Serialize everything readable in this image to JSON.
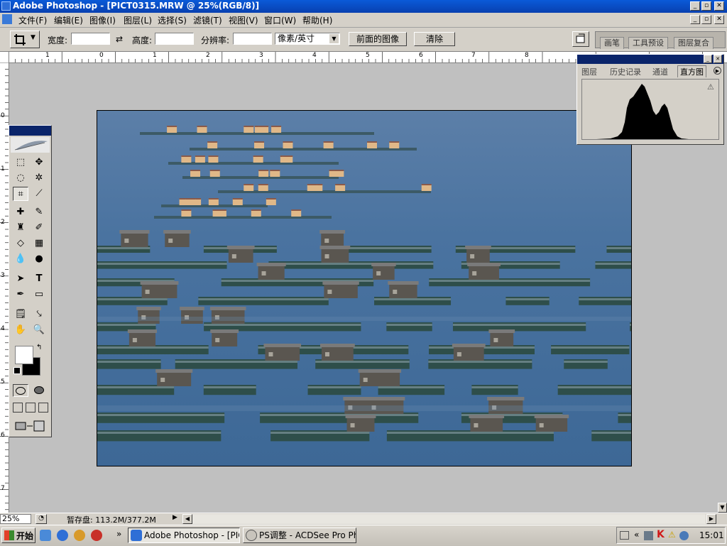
{
  "window": {
    "app_title": "Adobe Photoshop - [PICT0315.MRW @ 25%(RGB/8)]",
    "controls": [
      "_",
      "▫",
      "✕"
    ]
  },
  "menu": {
    "items": [
      "文件(F)",
      "编辑(E)",
      "图像(I)",
      "图层(L)",
      "选择(S)",
      "滤镜(T)",
      "视图(V)",
      "窗口(W)",
      "帮助(H)"
    ]
  },
  "options": {
    "width_label": "宽度:",
    "width_value": "",
    "height_label": "高度:",
    "height_value": "",
    "resolution_label": "分辨率:",
    "resolution_value": "",
    "unit_value": "像素/英寸",
    "front_image_label": "前面的图像",
    "clear_label": "清除",
    "palette_well_tabs": [
      "画笔",
      "工具预设",
      "图层复合"
    ]
  },
  "rulers": {
    "h_numbers": [
      "1",
      "0",
      "1",
      "2",
      "3",
      "4",
      "5",
      "6",
      "7",
      "8"
    ],
    "v_numbers": [
      "0",
      "1",
      "2",
      "3",
      "4",
      "5",
      "6",
      "7"
    ]
  },
  "histogram_palette": {
    "tabs": [
      "图层",
      "历史记录",
      "通道",
      "直方图"
    ],
    "warning_icon": "warning-icon"
  },
  "status": {
    "zoom": "25%",
    "scratch": "暂存盘: 113.2M/377.2M"
  },
  "taskbar": {
    "start_label": "开始",
    "tasks": [
      "Adobe Photoshop - [PIC...",
      "PS调整 - ACDSee Pro Ph..."
    ],
    "clock": "15:01",
    "colors": {
      "start_green": "#3a8a2e"
    }
  }
}
